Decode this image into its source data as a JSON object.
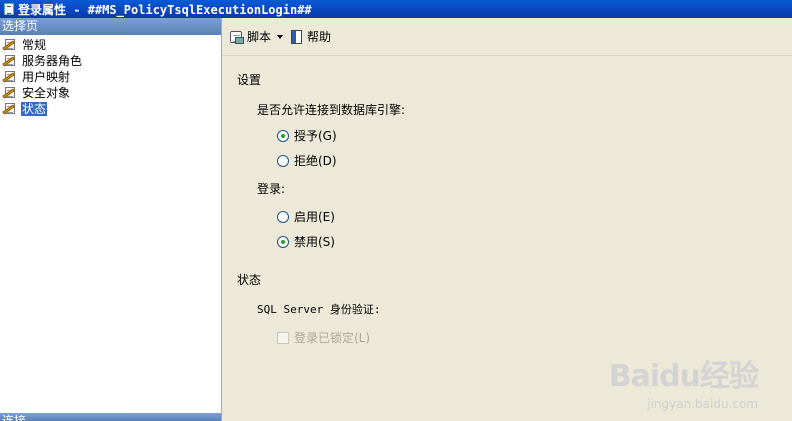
{
  "window": {
    "title": "登录属性 - ##MS_PolicyTsqlExecutionLogin##"
  },
  "left_pane": {
    "header": "选择页",
    "items": [
      {
        "label": "常规",
        "selected": false
      },
      {
        "label": "服务器角色",
        "selected": false
      },
      {
        "label": "用户映射",
        "selected": false
      },
      {
        "label": "安全对象",
        "selected": false
      },
      {
        "label": "状态",
        "selected": true
      }
    ],
    "connection_header": "连接"
  },
  "toolbar": {
    "script_label": "脚本",
    "help_label": "帮助"
  },
  "settings": {
    "section_title": "设置",
    "permission_label": "是否允许连接到数据库引擎:",
    "grant_label": "授予(G)",
    "deny_label": "拒绝(D)",
    "permission_selected": "grant",
    "login_label": "登录:",
    "enabled_label": "启用(E)",
    "disabled_label": "禁用(S)",
    "login_selected": "disabled"
  },
  "status": {
    "section_title": "状态",
    "auth_label": "SQL Server 身份验证:",
    "locked_label": "登录已锁定(L)",
    "locked_checked": false
  },
  "watermark": {
    "main": "Baidu经验",
    "sub": "jingyan.baidu.com"
  }
}
